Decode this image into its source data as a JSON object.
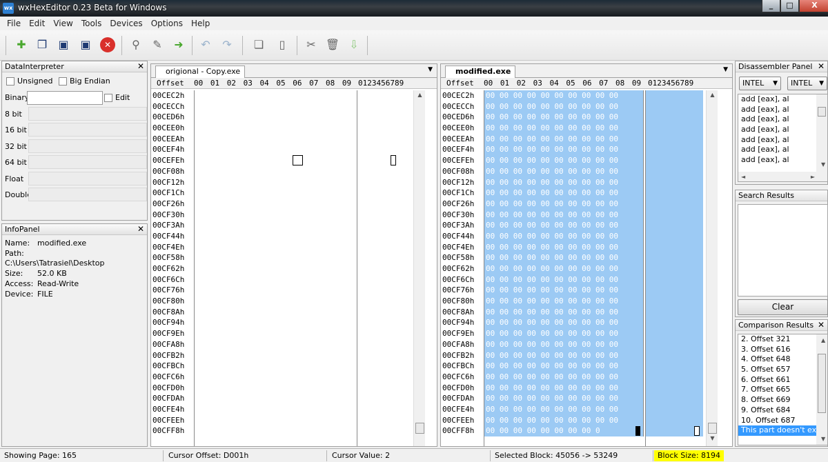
{
  "window": {
    "title": "wxHexEditor 0.23 Beta for Windows",
    "app_icon_text": "wx",
    "buttons": [
      "_",
      "□",
      "X"
    ]
  },
  "menu": [
    "File",
    "Edit",
    "View",
    "Tools",
    "Devices",
    "Options",
    "Help"
  ],
  "toolbar_icons": [
    "new-file",
    "open-file",
    "save",
    "save-as",
    "close",
    "find",
    "replace",
    "goto",
    "undo",
    "redo",
    "copy",
    "paste",
    "cut",
    "delete",
    "insert"
  ],
  "data_interpreter": {
    "title": "DataInterpreter",
    "unsigned_label": "Unsigned",
    "big_endian_label": "Big Endian",
    "binary_label": "Binary",
    "binary_value": "",
    "edit_label": "Edit",
    "rows": [
      "8 bit",
      "16 bit",
      "32 bit",
      "64 bit",
      "Float",
      "Double"
    ]
  },
  "info_panel": {
    "title": "InfoPanel",
    "name_label": "Name:",
    "name_value": "modified.exe",
    "path_label": "Path:",
    "path_value": "C:\\Users\\Tatrasiel\\Desktop",
    "size_label": "Size:",
    "size_value": "52.0 KB",
    "access_label": "Access:",
    "access_value": "Read-Write",
    "device_label": "Device:",
    "device_value": "FILE"
  },
  "hex_header": {
    "offset": "Offset",
    "columns": [
      "00",
      "01",
      "02",
      "03",
      "04",
      "05",
      "06",
      "07",
      "08",
      "09"
    ],
    "text_columns": "0123456789"
  },
  "offsets": [
    "00CEC2h",
    "00CECCh",
    "00CED6h",
    "00CEE0h",
    "00CEEAh",
    "00CEF4h",
    "00CEFEh",
    "00CF08h",
    "00CF12h",
    "00CF1Ch",
    "00CF26h",
    "00CF30h",
    "00CF3Ah",
    "00CF44h",
    "00CF4Eh",
    "00CF58h",
    "00CF62h",
    "00CF6Ch",
    "00CF76h",
    "00CF80h",
    "00CF8Ah",
    "00CF94h",
    "00CF9Eh",
    "00CFA8h",
    "00CFB2h",
    "00CFBCh",
    "00CFC6h",
    "00CFD0h",
    "00CFDAh",
    "00CFE4h",
    "00CFEEh",
    "00CFF8h"
  ],
  "left_pane": {
    "tab_label": "origional - Copy.exe"
  },
  "right_pane": {
    "tab_label": "modified.exe",
    "hex_row": "00 00 00 00 00 00 00 00 00 00",
    "last_row": "00 00 00 00 00 00 00 00 0"
  },
  "disassembler": {
    "title": "Disassembler Panel",
    "combo1": "INTEL",
    "combo2": "INTEL",
    "lines": [
      "add [eax], al",
      "add [eax], al",
      "add [eax], al",
      "add [eax], al",
      "add [eax], al",
      "add [eax], al",
      "add [eax], al"
    ]
  },
  "search_results": {
    "title": "Search Results",
    "clear_label": "Clear"
  },
  "comparison_results": {
    "title": "Comparison Results",
    "items": [
      "2. Offset 321",
      "3. Offset 616",
      "4. Offset 648",
      "5. Offset 657",
      "6. Offset 661",
      "7. Offset 665",
      "8. Offset 669",
      "9. Offset 684",
      "10. Offset 687"
    ],
    "selected_item": "This part doesn't exist"
  },
  "status": {
    "showing_page": "Showing Page: 165",
    "cursor_offset": "Cursor Offset: D001h",
    "cursor_value": "Cursor Value: 2",
    "selected_block": "Selected Block: 45056 -> 53249",
    "block_size": "Block Size: 8194"
  },
  "colors": {
    "selection": "#9ccaf4",
    "highlight": "#ffff00",
    "list_selection": "#3399ff"
  }
}
